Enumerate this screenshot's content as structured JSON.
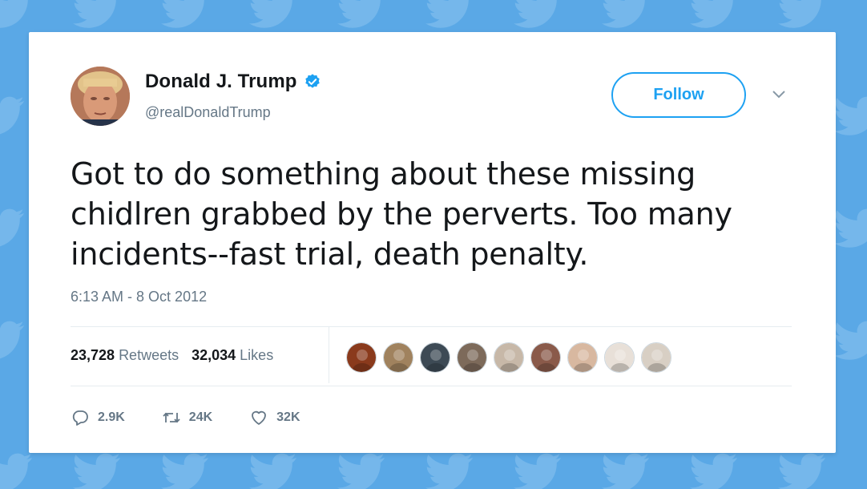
{
  "tweet": {
    "author_name": "Donald J. Trump",
    "handle": "@realDonaldTrump",
    "follow_label": "Follow",
    "text_lines": [
      "Got to do something about these missing",
      "chidlren grabbed by the perverts. Too many",
      "incidents--fast trial, death penalty."
    ],
    "timestamp": "6:13 AM - 8 Oct 2012",
    "retweets_count": "23,728",
    "retweets_label": "Retweets",
    "likes_count": "32,034",
    "likes_label": "Likes",
    "actions": {
      "replies": "2.9K",
      "retweets": "24K",
      "likes": "32K"
    }
  },
  "icons": {
    "verified": "verified-badge-icon",
    "caret": "chevron-down-icon",
    "reply": "reply-icon",
    "retweet": "retweet-icon",
    "like": "heart-icon",
    "background": "twitter-bird-icon"
  },
  "colors": {
    "background": "#5aa8e6",
    "accent": "#1da1f2",
    "text": "#14171a",
    "secondary_text": "#657786"
  },
  "liker_avatars": [
    "#8a3a1c",
    "#a0825e",
    "#3d4a55",
    "#7d6a5a",
    "#c7b8a8",
    "#8a5a4a",
    "#d8b8a0",
    "#e8e0d8",
    "#d8cfc4"
  ]
}
